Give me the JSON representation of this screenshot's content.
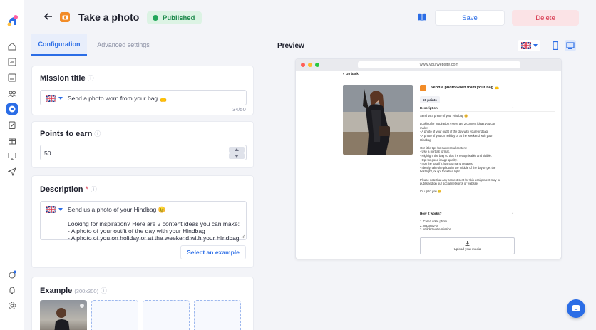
{
  "header": {
    "title": "Take a photo",
    "status": "Published",
    "save_label": "Save",
    "delete_label": "Delete"
  },
  "tabs": [
    "Configuration",
    "Advanced settings"
  ],
  "mission_title": {
    "label": "Mission title",
    "value": "Send a photo worn from your bag 👝",
    "counter": "34/50"
  },
  "points": {
    "label": "Points to earn",
    "value": "50"
  },
  "description": {
    "label": "Description",
    "required_mark": "*",
    "text": "Send us a photo of your Hindbag 😊\n\nLooking for inspiration? Here are 2 content ideas you can make:\n- A photo of your outfit of the day with your Hindbag\n- A photo of you on holiday or at the weekend with your Hindbag",
    "select_example": "Select an example"
  },
  "example": {
    "label": "Example",
    "size_hint": "(300x300)"
  },
  "preview": {
    "label": "Preview",
    "url": "www.yourwebsite.com",
    "go_back": "Go back",
    "title": "Send a photo worn from your bag 👝",
    "points": "50 points",
    "description_label": "Description",
    "description_text": "Send us a photo of your Hindbag 😊\n\nLooking for inspiration? Here are 2 content ideas you can\nmake:\n- A photo of your outfit of the day with your Hindbag\n- A photo of you on holiday or at the weekend with your\nHindbag\n\nOur little tips for successful content:\n- Use a portrait format.\n- Highlight the bag so that it's recognisable and visible.\n- Opt for good image quality.\n- Iron the bag if it has too many creases.\n- Ideally, take the photo in the middle of the day to get the\nbest light, or opt for white light.\n\nPlease note that any content sent for this assignment may be\npublished on our social networks or website.\n\nIt's up to you 😊",
    "how_label": "How it works?",
    "how_text": "1. Créez votre photo\n2. Importez-la\n3. Validez votre mission",
    "upload": "Upload your media"
  },
  "colors": {
    "accent": "#2b6de6",
    "published_bg": "#dcf3e4",
    "published_fg": "#1f8a4d",
    "delete_bg": "#fbe3e6",
    "delete_fg": "#d6334a",
    "mission_icon": "#f28c28"
  },
  "icons": {
    "rail": [
      "home-icon",
      "stats-icon",
      "image-icon",
      "users-icon",
      "missions-icon",
      "clipboard-icon",
      "gift-icon",
      "monitor-icon",
      "send-icon",
      "add-notification-icon",
      "bell-icon",
      "settings-icon"
    ]
  }
}
